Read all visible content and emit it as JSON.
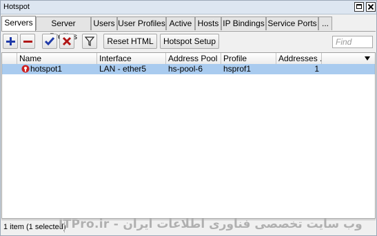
{
  "window": {
    "title": "Hotspot"
  },
  "tabs": [
    {
      "label": "Servers",
      "active": true
    },
    {
      "label": "Server Profiles"
    },
    {
      "label": "Users"
    },
    {
      "label": "User Profiles"
    },
    {
      "label": "Active"
    },
    {
      "label": "Hosts"
    },
    {
      "label": "IP Bindings"
    },
    {
      "label": "Service Ports"
    },
    {
      "label": "..."
    }
  ],
  "toolbar": {
    "add_icon": "plus-icon",
    "remove_icon": "minus-icon",
    "enable_icon": "check-icon",
    "disable_icon": "x-icon",
    "filter_icon": "filter-icon",
    "reset_html_label": "Reset HTML",
    "hotspot_setup_label": "Hotspot Setup",
    "find_placeholder": "Find"
  },
  "table": {
    "columns": [
      "Name",
      "Interface",
      "Address Pool",
      "Profile",
      "Addresses ..."
    ],
    "rows": [
      {
        "icon": "hotspot-server-icon",
        "name": "hotspot1",
        "interface": "LAN - ether5",
        "address_pool": "hs-pool-6",
        "profile": "hsprof1",
        "addresses": "1"
      }
    ]
  },
  "status": {
    "text": "1 item (1 selected)",
    "watermark": "ITPro.ir - وب سایت تخصصی فناوری اطلاعات ایران"
  },
  "colors": {
    "selection": "#a9cbef",
    "add": "#1f3aa8",
    "remove": "#b01515",
    "enable": "#1f3aa8",
    "disable": "#b01515"
  }
}
